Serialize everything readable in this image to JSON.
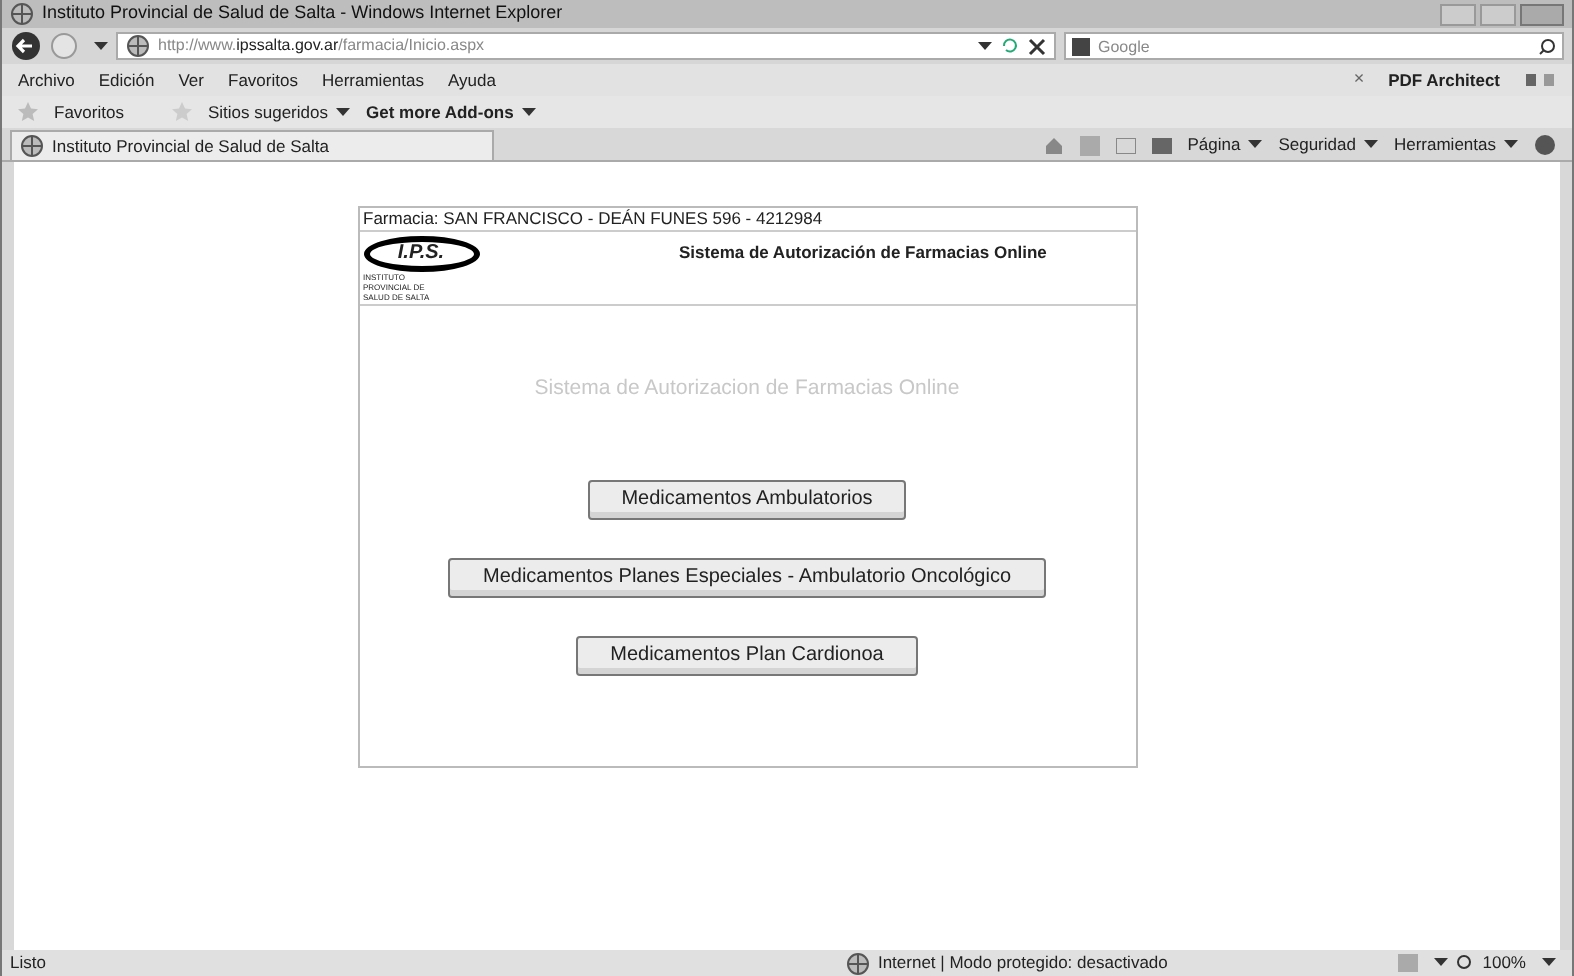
{
  "window": {
    "title": "Instituto Provincial de Salud de Salta - Windows Internet Explorer"
  },
  "address_bar": {
    "url_prefix": "http://www.",
    "url_host": "ipssalta.gov.ar",
    "url_path": "/farmacia/Inicio.aspx"
  },
  "search": {
    "placeholder": "Google"
  },
  "menu": [
    "Archivo",
    "Edición",
    "Ver",
    "Favoritos",
    "Herramientas",
    "Ayuda"
  ],
  "pdf_toolbar": {
    "label": "PDF Architect",
    "close": "×"
  },
  "favorites_bar": {
    "favorites": "Favoritos",
    "suggested": "Sitios sugeridos",
    "addons": "Get more Add-ons"
  },
  "tab": {
    "title": "Instituto Provincial de Salud de Salta"
  },
  "command_bar": [
    "Página",
    "Seguridad",
    "Herramientas"
  ],
  "page": {
    "pharmacy": "Farmacia: SAN FRANCISCO - DEÁN FUNES 596 - 4212984",
    "logo": {
      "mark": "I.P.S.",
      "caption": "INSTITUTO PROVINCIAL DE SALUD DE SALTA"
    },
    "header_title": "Sistema de Autorización de Farmacias Online",
    "subtitle": "Sistema de Autorizacion de Farmacias Online",
    "buttons": [
      "Medicamentos Ambulatorios",
      "Medicamentos Planes Especiales - Ambulatorio Oncológico",
      "Medicamentos Plan Cardionoa"
    ]
  },
  "status_bar": {
    "left": "Listo",
    "zone": "Internet | Modo protegido: desactivado",
    "zoom": "100%"
  }
}
